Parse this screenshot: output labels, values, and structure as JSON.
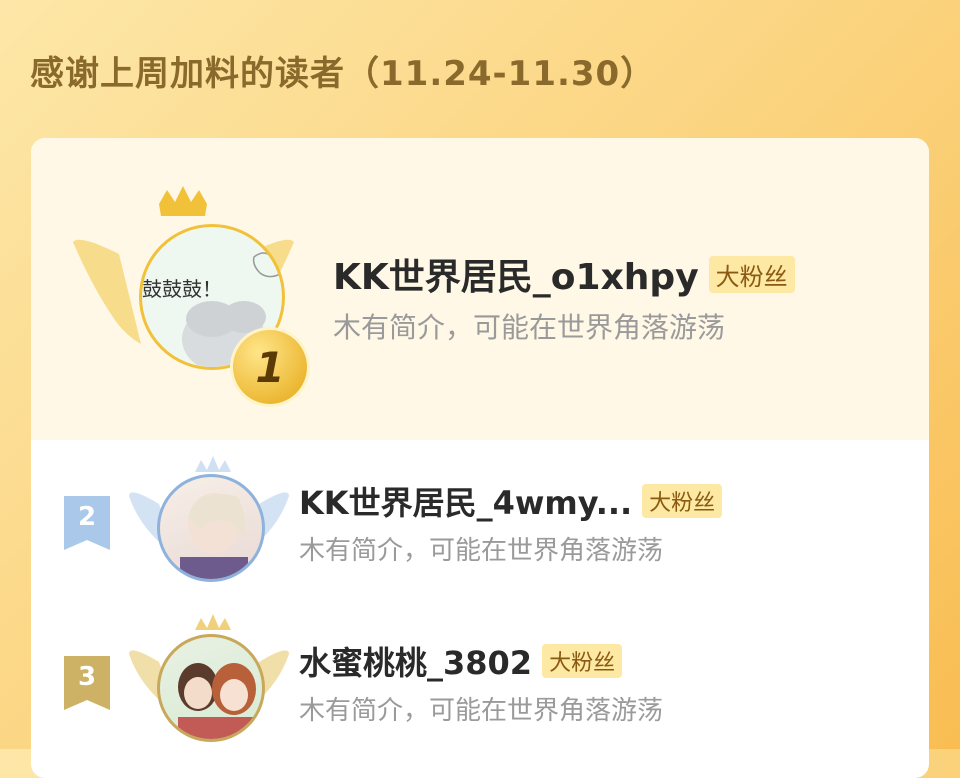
{
  "page": {
    "title": "感谢上周加料的读者（11.24-11.30）"
  },
  "colors": {
    "gold": "#f2c13a",
    "badge_bg": "#fde9a3",
    "badge_text": "#8b5a12",
    "silver": "#9fbfe0",
    "bronze": "#c8a85a"
  },
  "readers": [
    {
      "rank": "1",
      "name": "KK世界居民_o1xhpy",
      "badge": "大粉丝",
      "bio": "木有简介，可能在世界角落游荡",
      "avatar_text": "鼓鼓鼓！"
    },
    {
      "rank": "2",
      "name": "KK世界居民_4wmy...",
      "badge": "大粉丝",
      "bio": "木有简介，可能在世界角落游荡"
    },
    {
      "rank": "3",
      "name": "水蜜桃桃_3802",
      "badge": "大粉丝",
      "bio": "木有简介，可能在世界角落游荡"
    }
  ]
}
